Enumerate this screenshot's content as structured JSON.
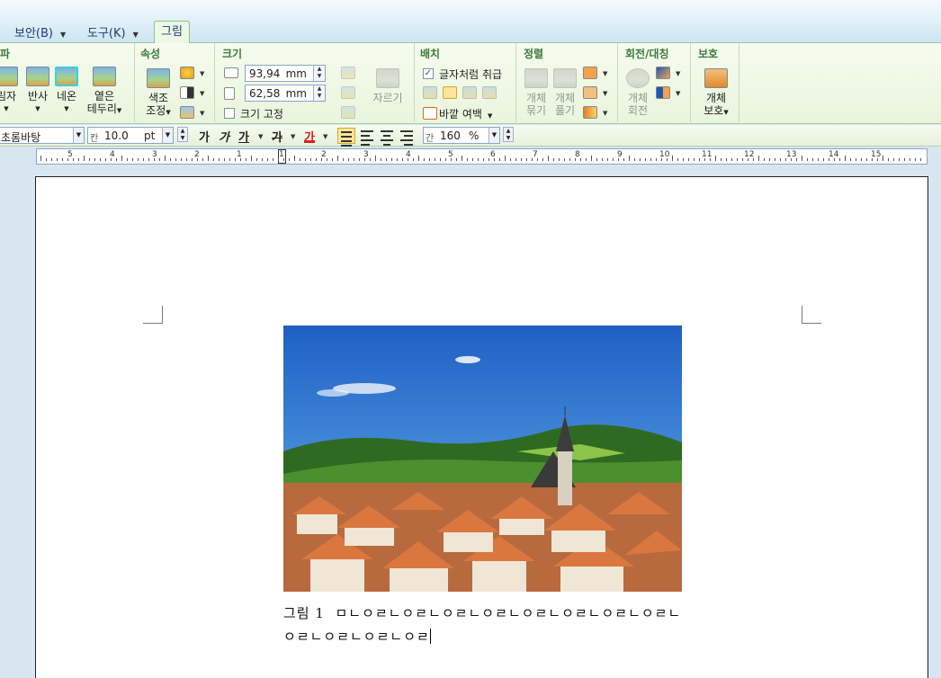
{
  "tabs": [
    {
      "label": "보안(B)"
    },
    {
      "label": "도구(K)"
    }
  ],
  "active_tab": {
    "label": "그림"
  },
  "ribbon": {
    "style_group": {
      "title": "파",
      "buttons": [
        {
          "label": "림자"
        },
        {
          "label": "반사"
        },
        {
          "label": "네온"
        },
        {
          "label_line1": "옅은",
          "label_line2": "테두리"
        }
      ]
    },
    "properties_group": {
      "title": "속성",
      "color_adjust": {
        "line1": "색조",
        "line2": "조정"
      }
    },
    "size_group": {
      "title": "크기",
      "width": {
        "value": "93,94",
        "unit": "mm"
      },
      "height": {
        "value": "62,58",
        "unit": "mm"
      },
      "fix_size": {
        "label": "크기 고정",
        "checked": false
      },
      "crop": {
        "label": "자르기"
      }
    },
    "arrange_group": {
      "title": "배치",
      "treat_as_char": {
        "label": "글자처럼 취급",
        "checked": true
      },
      "outer_margin": {
        "label": "바깥 여백"
      }
    },
    "align_group": {
      "title": "정렬",
      "group_objects": {
        "line1": "개체",
        "line2": "묶기"
      },
      "ungroup_objects": {
        "line1": "개체",
        "line2": "풀기"
      }
    },
    "rotate_group": {
      "title": "회전/대칭",
      "rotate_object": {
        "line1": "개체",
        "line2": "회전"
      }
    },
    "protect_group": {
      "title": "보호",
      "protect_object": {
        "line1": "개체",
        "line2": "보호"
      }
    }
  },
  "format_bar": {
    "font_name": "초롬바탕",
    "font_size_prefix": "칸",
    "font_size": "10.0",
    "font_size_unit": "pt",
    "bold": "가",
    "italic": "가",
    "underline": "가",
    "strike": "가",
    "font_color_label": "가",
    "font_color": "#d42020",
    "line_spacing_prefix": "간",
    "line_spacing": "160",
    "line_spacing_unit": "%"
  },
  "ruler": {
    "labels": [
      "5",
      "4",
      "3",
      "2",
      "1",
      "1",
      "2",
      "3",
      "4",
      "5",
      "6",
      "7",
      "8",
      "9",
      "10",
      "11",
      "12",
      "13",
      "14",
      "15"
    ]
  },
  "document": {
    "caption_label": "그림 1",
    "caption_text": "ㅁㄴㅇㄹㄴㅇㄹㄴㅇㄹㄴㅇㄹㄴㅇㄹㄴㅇㄹㄴㅇㄹㄴㅇㄹㄴ",
    "caption_text_line2": "ㅇㄹㄴㅇㄹㄴㅇㄹㄴㅇㄹ"
  },
  "colors": {
    "ribbon_bg": "#e9f5dd",
    "group_title": "#3a7a3a",
    "tab_text": "#1b3d73",
    "workspace_bg": "#d8e6f1"
  }
}
